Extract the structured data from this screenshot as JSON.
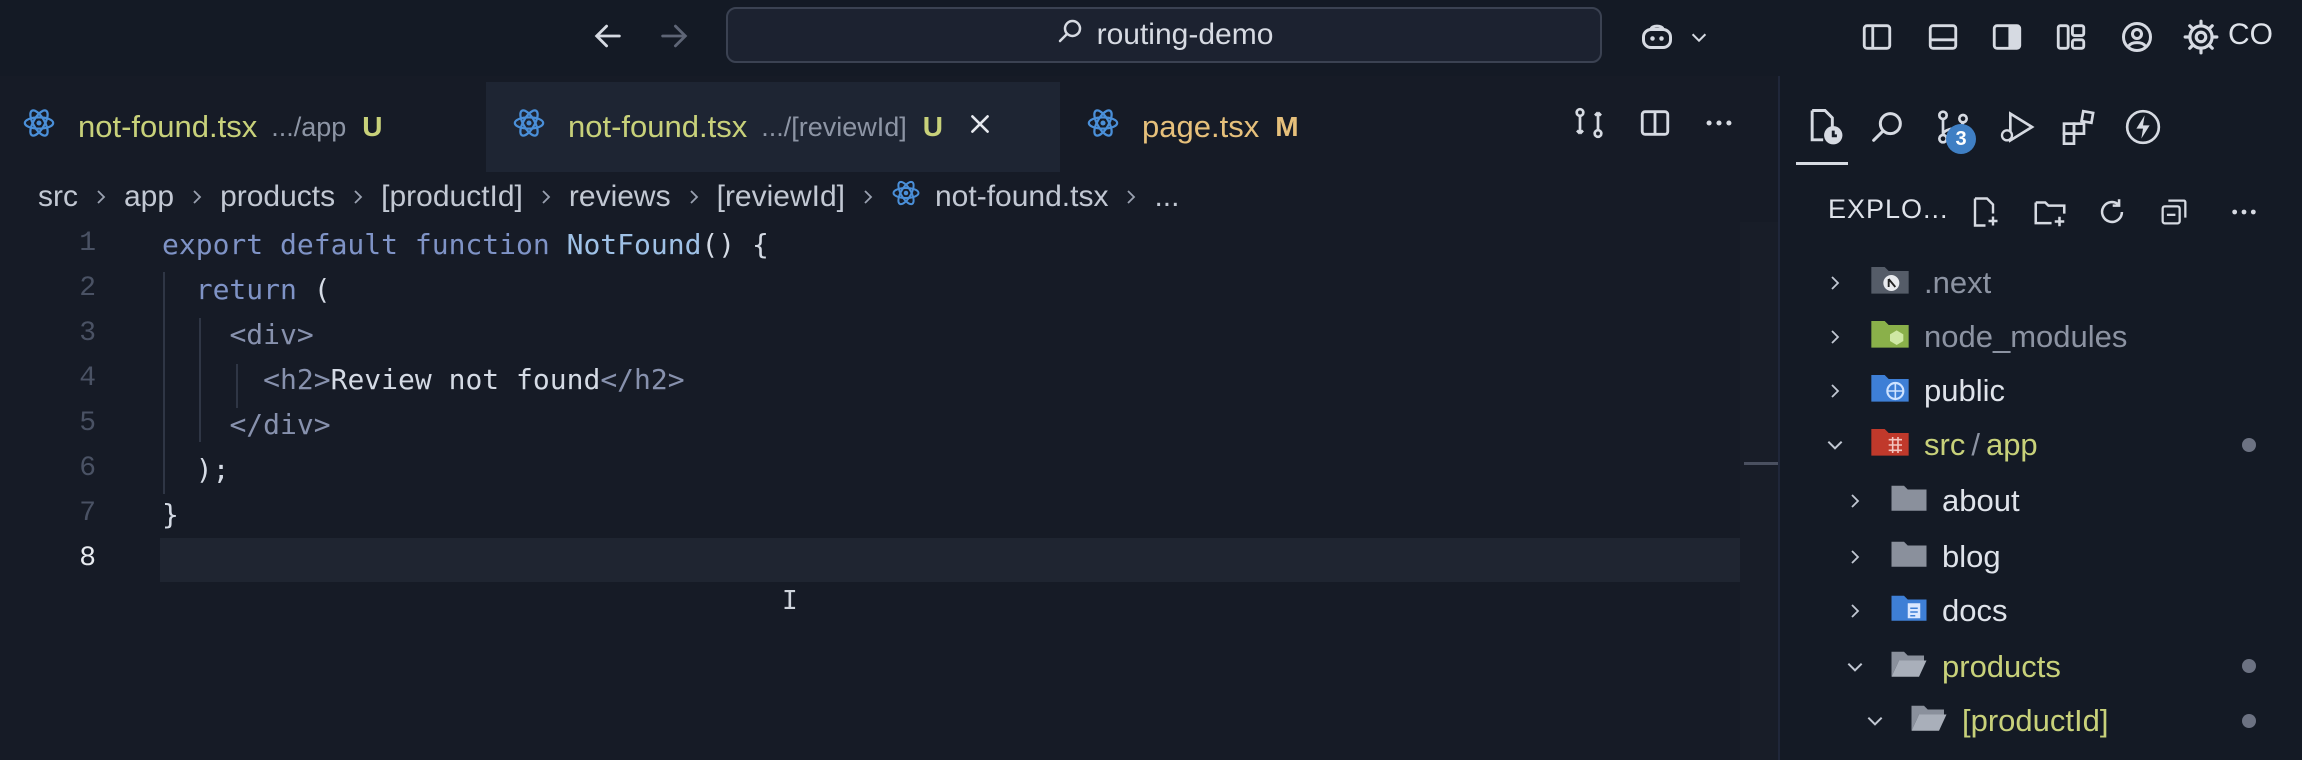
{
  "titlebar": {
    "search_text": "routing-demo",
    "account_label": "CO"
  },
  "tabs": [
    {
      "name": "not-found.tsx",
      "dir": ".../app",
      "status": "U",
      "active": false
    },
    {
      "name": "not-found.tsx",
      "dir": ".../[reviewId]",
      "status": "U",
      "active": true
    },
    {
      "name": "page.tsx",
      "dir": "",
      "status": "M",
      "active": false
    }
  ],
  "breadcrumb": [
    "src",
    "app",
    "products",
    "[productId]",
    "reviews",
    "[reviewId]",
    "not-found.tsx",
    "..."
  ],
  "editor": {
    "line_numbers": [
      "1",
      "2",
      "3",
      "4",
      "5",
      "6",
      "7",
      "8"
    ],
    "active_line": "8"
  },
  "sidebar": {
    "scm_badge": "3",
    "explorer_title": "EXPLO...",
    "tree": [
      {
        "label": ".next",
        "expanded": false
      },
      {
        "label": "node_modules",
        "expanded": false
      },
      {
        "label": "public",
        "expanded": false
      },
      {
        "label": "src",
        "label2": "app",
        "expanded": true
      },
      {
        "label": "about",
        "expanded": false
      },
      {
        "label": "blog",
        "expanded": false
      },
      {
        "label": "docs",
        "expanded": false
      },
      {
        "label": "products",
        "expanded": true
      },
      {
        "label": "[productId]",
        "expanded": true
      }
    ]
  },
  "colors": {
    "untracked": "#c8d17a",
    "modified": "#e6c07b",
    "react": "#4a8fd8",
    "background": "#161b26"
  }
}
